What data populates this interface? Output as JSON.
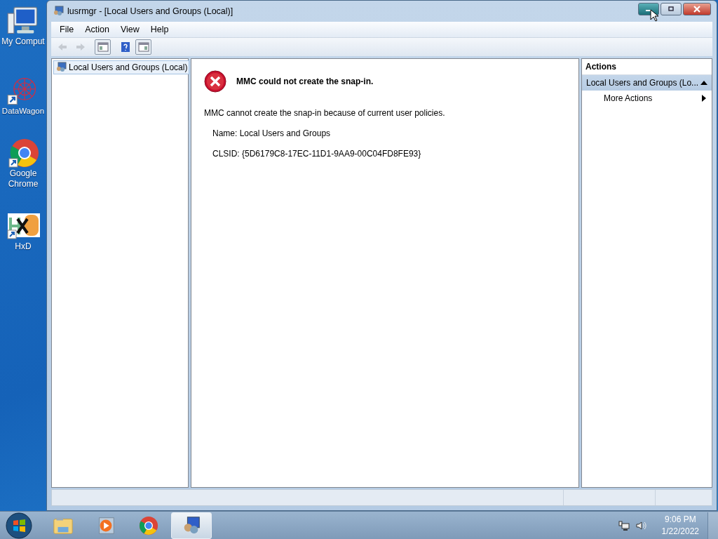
{
  "desktop_icons": [
    {
      "kind": "computer",
      "label": "My Comput"
    },
    {
      "kind": "star",
      "label": "DataWagon"
    },
    {
      "kind": "browser",
      "label": "Google Chrome"
    },
    {
      "kind": "hex",
      "label": "HxD"
    }
  ],
  "window": {
    "title": "lusrmgr - [Local Users and Groups (Local)]",
    "caption_buttons": [
      {
        "kind": "minimize",
        "hovered": true
      },
      {
        "kind": "maximize",
        "hovered": false
      },
      {
        "kind": "close",
        "hovered": false
      }
    ]
  },
  "menu": [
    "File",
    "Action",
    "View",
    "Help"
  ],
  "toolbar": [
    {
      "kind": "back",
      "disabled": true,
      "pressed": false
    },
    {
      "kind": "forward",
      "disabled": true,
      "pressed": false
    },
    {
      "kind": "tree",
      "disabled": false,
      "pressed": true
    },
    {
      "kind": "help",
      "disabled": false,
      "pressed": false
    },
    {
      "kind": "pane",
      "disabled": false,
      "pressed": true
    }
  ],
  "tree": [
    {
      "label": "Local Users and Groups (Local)",
      "selected": true
    }
  ],
  "error": {
    "title": "MMC could not create the snap-in.",
    "message": "MMC cannot create the snap-in because of current user policies.",
    "details": [
      "Name: Local Users and Groups",
      "CLSID: {5D6179C8-17EC-11D1-9AA9-00C04FD8FE93}"
    ]
  },
  "actions": {
    "header": "Actions",
    "group": {
      "label": "Local Users and Groups (Lo...",
      "expanded": true
    },
    "items": [
      {
        "label": "More Actions",
        "submenu": true
      }
    ]
  },
  "taskbar": [
    {
      "kind": "folder",
      "selected": false
    },
    {
      "kind": "media",
      "selected": false
    },
    {
      "kind": "browser",
      "selected": false
    },
    {
      "kind": "console",
      "selected": true
    }
  ],
  "tray": {
    "time": "9:06 PM",
    "date": "1/22/2022"
  }
}
